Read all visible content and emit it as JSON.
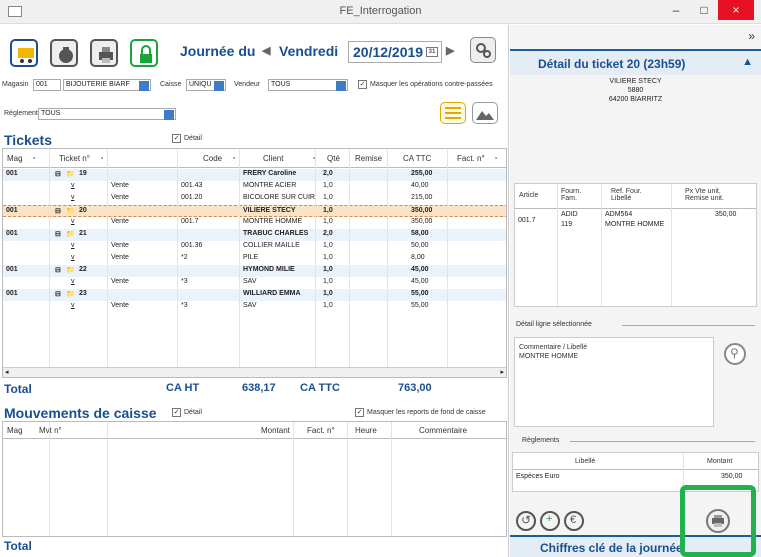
{
  "window": {
    "title": "FE_Interrogation",
    "minimize": "–",
    "maximize": "□",
    "close": "×"
  },
  "header": {
    "journee_label": "Journée du",
    "day": "Vendredi",
    "date": "20/12/2019",
    "calendar_glyph": "31"
  },
  "filters": {
    "magasin_label": "Magasin",
    "magasin_code": "001",
    "magasin_name": "BIJOUTERIE BIARF",
    "caisse_label": "Caisse",
    "caisse_value": "UNIQU",
    "vendeur_label": "Vendeur",
    "vendeur_value": "TOUS",
    "masquer_label": "Masquer les opérations contre-passées",
    "reglement_label": "Règlement",
    "reglement_value": "TOUS"
  },
  "tickets": {
    "title": "Tickets",
    "detail_label": "Détail",
    "columns": [
      "Mag",
      "Ticket n°",
      "Code",
      "Client",
      "Qté",
      "Remise",
      "CA TTC",
      "Fact. n°"
    ],
    "rows": [
      {
        "mag": "001",
        "ticket": "19",
        "code": "",
        "client": "FRERY Caroline",
        "qte": "2,0",
        "ca": "255,00",
        "type": "head"
      },
      {
        "mag": "",
        "ticket": "",
        "label": "Vente",
        "code": "001.43",
        "client": "MONTRE ACIER",
        "qte": "1,0",
        "ca": "40,00",
        "type": "line"
      },
      {
        "mag": "",
        "ticket": "",
        "label": "Vente",
        "code": "001.20",
        "client": "BICOLORE SUR CUIR",
        "qte": "1,0",
        "ca": "215,00",
        "type": "line"
      },
      {
        "mag": "001",
        "ticket": "20",
        "code": "",
        "client": "VILIERE STECY",
        "qte": "1,0",
        "ca": "350,00",
        "type": "selected"
      },
      {
        "mag": "",
        "ticket": "",
        "label": "Vente",
        "code": "001.7",
        "client": "MONTRE HOMME",
        "qte": "1,0",
        "ca": "350,00",
        "type": "line"
      },
      {
        "mag": "001",
        "ticket": "21",
        "code": "",
        "client": "TRABUC CHARLES",
        "qte": "2,0",
        "ca": "58,00",
        "type": "head"
      },
      {
        "mag": "",
        "ticket": "",
        "label": "Vente",
        "code": "001.36",
        "client": "COLLIER MAILLE",
        "qte": "1,0",
        "ca": "50,00",
        "type": "line"
      },
      {
        "mag": "",
        "ticket": "",
        "label": "Vente",
        "code": "*2",
        "client": "PILE",
        "qte": "1,0",
        "ca": "8,00",
        "type": "line"
      },
      {
        "mag": "001",
        "ticket": "22",
        "code": "",
        "client": "HYMOND MILIE",
        "qte": "1,0",
        "ca": "45,00",
        "type": "head"
      },
      {
        "mag": "",
        "ticket": "",
        "label": "Vente",
        "code": "*3",
        "client": "SAV",
        "qte": "1,0",
        "ca": "45,00",
        "type": "line"
      },
      {
        "mag": "001",
        "ticket": "23",
        "code": "",
        "client": "WILLIARD EMMA",
        "qte": "1,0",
        "ca": "55,00",
        "type": "head"
      },
      {
        "mag": "",
        "ticket": "",
        "label": "Vente",
        "code": "*3",
        "client": "SAV",
        "qte": "1,0",
        "ca": "55,00",
        "type": "line"
      }
    ]
  },
  "totals": {
    "total_label": "Total",
    "caht_label": "CA HT",
    "caht_value": "638,17",
    "cattc_label": "CA TTC",
    "cattc_value": "763,00"
  },
  "mouvements": {
    "title": "Mouvements de caisse",
    "detail_label": "Détail",
    "masquer_label": "Masquer les reports de fond de caisse",
    "columns": [
      "Mag",
      "Mvt n°",
      "Montant",
      "Fact. n°",
      "Heure",
      "Commentaire"
    ],
    "total_label": "Total"
  },
  "right": {
    "expand_glyph": "»",
    "ticket_title": "Détail du ticket 20 (23h59)",
    "client_name": "VILIERE STECY",
    "client_code": "5880",
    "client_city": "64200 BIARRITZ",
    "art_columns": [
      "Article",
      "Fourn. Fam.",
      "Ref. Four. Libellé",
      "Px Vte unit. Remise unit."
    ],
    "art_row": {
      "article": "001.7",
      "fourn": "ADID",
      "fam": "119",
      "ref": "ADM564",
      "libelle": "MONTRE HOMME",
      "prix": "350,00"
    },
    "detail_ligne_label": "Détail ligne sélectionnée",
    "comment_label": "Commentaire / Libellé",
    "comment_value": "MONTRE HOMME",
    "reglements_label": "Règlements",
    "reg_columns": [
      "Libellé",
      "Montant"
    ],
    "reg_row": {
      "libelle": "Espèces Euro",
      "montant": "350,00"
    },
    "chiffres_label": "Chiffres clé de la journée"
  },
  "colors": {
    "accent": "#1a4f8f",
    "selected_row": "#fbe3c8",
    "highlight": "#22b14c"
  }
}
